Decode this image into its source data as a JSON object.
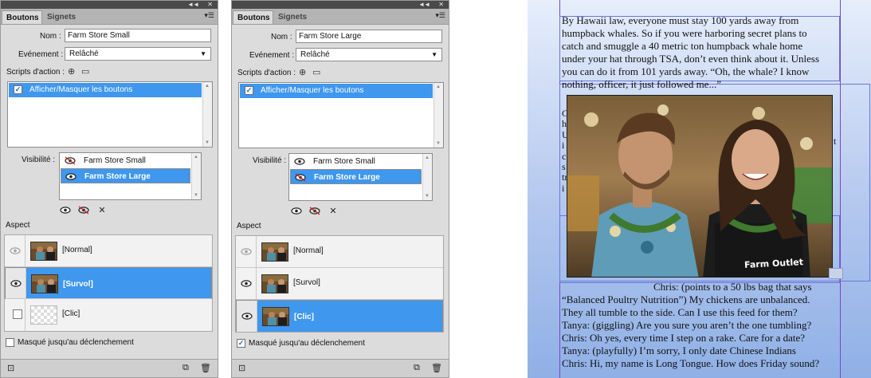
{
  "panel_left": {
    "tabs": [
      "Boutons",
      "Signets"
    ],
    "name_label": "Nom :",
    "name_value": "Farm Store Small",
    "event_label": "Evénement :",
    "event_value": "Relâché",
    "actions_label": "Scripts d'action :",
    "action_item": "Afficher/Masquer les boutons",
    "visibility_label": "Visibilité :",
    "visibility_items": [
      "Farm Store Small",
      "Farm Store Large"
    ],
    "aspect_label": "Aspect",
    "aspect_states": [
      "[Normal]",
      "[Survol]",
      "[Clic]"
    ],
    "masque_label": "Masqué jusqu'au déclenchement",
    "masque_checked": false
  },
  "panel_right": {
    "tabs": [
      "Boutons",
      "Signets"
    ],
    "name_label": "Nom :",
    "name_value": "Farm Store Large",
    "event_label": "Evénement :",
    "event_value": "Relâché",
    "actions_label": "Scripts d'action :",
    "action_item": "Afficher/Masquer les boutons",
    "visibility_label": "Visibilité :",
    "visibility_items": [
      "Farm Store Small",
      "Farm Store Large"
    ],
    "aspect_label": "Aspect",
    "aspect_states": [
      "[Normal]",
      "[Survol]",
      "[Clic]"
    ],
    "masque_label": "Masqué jusqu'au déclenchement",
    "masque_checked": true
  },
  "document": {
    "top_lines": [
      "By Hawaii law, everyone must stay 100 yards away from",
      "humpback whales. So if you were harboring secret plans to",
      "catch and smuggle a 40 metric ton humpback whale home",
      "under your hat through TSA, don’t even think about it. Unless",
      "you can do it from 101 yards away. “Oh, the whale? I know",
      "nothing, officer, it just followed me...”"
    ],
    "hidden_line_starts": [
      "C",
      "h",
      "U",
      "i",
      "c",
      "s",
      "tr",
      "i"
    ],
    "hidden_right_char": "t",
    "photo_label": "Farm Outlet",
    "bottom_lines": [
      "Chris: (points to a 50 lbs bag that says",
      "“Balanced Poultry Nutrition”) My chickens are unbalanced.",
      "They all tumble to the side. Can I use this feed for them?",
      "Tanya: (giggling) Are you sure you aren’t the one tumbling?",
      "Chris: Oh yes, every time I step on a rake. Care for a date?",
      "Tanya: (playfully) I’m sorry, I only date Chinese Indians",
      "Chris: Hi, my name is Long Tongue. How does Friday sound?"
    ]
  },
  "colors": {
    "panel_bg": "#dcdcdc",
    "selection": "#3f97ee",
    "guide": "#7a46c9",
    "frame": "#6b77d8"
  }
}
